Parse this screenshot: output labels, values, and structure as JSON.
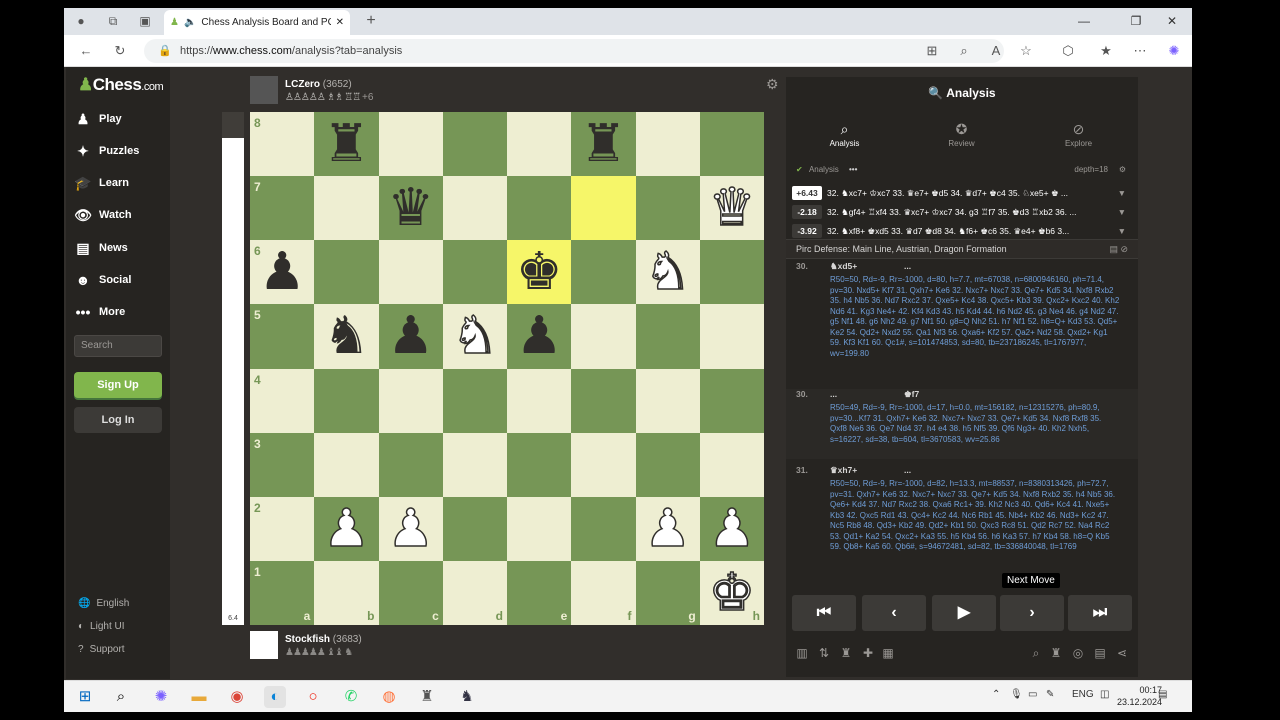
{
  "browser": {
    "tab_title": "Chess Analysis Board and PG",
    "url_prefix": "https://",
    "url_host": "www.chess.com",
    "url_path": "/analysis?tab=analysis"
  },
  "sidebar": {
    "logo_text": "Chess",
    "logo_domain": ".com",
    "items": [
      {
        "label": "Play",
        "icon": "♟"
      },
      {
        "label": "Puzzles",
        "icon": "✦"
      },
      {
        "label": "Learn",
        "icon": "🎓"
      },
      {
        "label": "Watch",
        "icon": "👁"
      },
      {
        "label": "News",
        "icon": "▤"
      },
      {
        "label": "Social",
        "icon": "☻"
      },
      {
        "label": "More",
        "icon": "•••"
      }
    ],
    "search_placeholder": "Search",
    "signup_label": "Sign Up",
    "login_label": "Log In",
    "settings": [
      {
        "label": "English",
        "icon": "🌐"
      },
      {
        "label": "Light UI",
        "icon": "◐"
      },
      {
        "label": "Support",
        "icon": "?"
      }
    ]
  },
  "board": {
    "top_player": {
      "name": "LCZero",
      "rating": "(3652)",
      "captured": "♙♙♙♙♙ ♗♗ ♖♖",
      "advantage": "+6"
    },
    "bottom_player": {
      "name": "Stockfish",
      "rating": "(3683)",
      "captured": "♟♟♟♟♟ ♝♝ ♞"
    },
    "eval_value": "6.4",
    "eval_white_fraction": 0.95,
    "ranks": [
      "8",
      "7",
      "6",
      "5",
      "4",
      "3",
      "2",
      "1"
    ],
    "files": [
      "a",
      "b",
      "c",
      "d",
      "e",
      "f",
      "g",
      "h"
    ],
    "highlight_squares": [
      "f7",
      "e6"
    ],
    "pieces": {
      "b8": "br",
      "f8": "br",
      "c7": "bq",
      "h7": "wq",
      "a6": "bp",
      "e6": "bk",
      "g6": "wn",
      "b5": "bn",
      "c5": "bp",
      "d5": "wn",
      "e5": "bp",
      "b2": "wp",
      "c2": "wp",
      "g2": "wp",
      "h2": "wp",
      "h1": "wk"
    }
  },
  "analysis": {
    "title": "Analysis",
    "tabs": [
      {
        "label": "Analysis",
        "icon": "search-icon"
      },
      {
        "label": "Review",
        "icon": "star-icon"
      },
      {
        "label": "Explore",
        "icon": "compass-icon"
      }
    ],
    "toggle_label": "Analysis",
    "depth": "depth=18",
    "lines": [
      {
        "eval": "+6.43",
        "moves": "32. ♞xc7+ ♔xc7 33. ♛e7+ ♚d5 34. ♛d7+ ♚c4 35. ♘xe5+ ♚ ..."
      },
      {
        "eval": "-2.18",
        "moves": "32. ♞gf4+ ♖xf4 33. ♛xc7+ ♔xc7 34. g3 ♖f7 35. ♚d3 ♖xb2 36. ..."
      },
      {
        "eval": "-3.92",
        "moves": "32. ♞xf8+ ♚xd5 33. ♛d7 ♚d8 34. ♞f6+ ♚c6 35. ♛e4+ ♚b6 3..."
      }
    ],
    "opening": "Pirc Defense: Main Line, Austrian, Dragon Formation",
    "move_blocks": [
      {
        "num": "30.",
        "white": "♞xd5+",
        "black": "...",
        "text": "R50=50, Rd=-9, Rr=-1000, d=80, h=7.7, mt=67038, n=6800946160, ph=71.4, pv=30. Nxd5+ Kf7 31. Qxh7+ Ke6 32. Nxc7+ Nxc7 33. Qe7+ Kd5 34. Nxf8 Rxb2 35. h4 Nb5 36. Nd7 Rxc2 37. Qxe5+ Kc4 38. Qxc5+ Kb3 39. Qxc2+ Kxc2 40. Kh2 Nd6 41. Kg3 Ne4+ 42. Kf4 Kd3 43. h5 Kd4 44. h6 Nd2 45. g3 Ne4 46. g4 Nd2 47. g5 Nf1 48. g6 Nh2 49. g7 Nf1 50. g8=Q Nh2 51. h7 Nf1 52. h8=Q+ Kd3 53. Qd5+ Ke2 54. Qd2+ Nxd2 55. Qa1 Nf3 56. Qxa6+ Kf2 57. Qa2+ Nd2 58. Qxd2+ Kg1 59. Kf3 Kf1 60. Qc1#, s=101474853, sd=80, tb=237186245, tl=1767977, wv=199.80"
      },
      {
        "num": "30.",
        "white": "...",
        "black": "♚f7",
        "text": "R50=49, Rd=-9, Rr=-1000, d=17, h=0.0, mt=156182, n=12315276, ph=80.9, pv=30...Kf7 31. Qxh7+ Ke6 32. Nxc7+ Nxc7 33. Qe7+ Kd5 34. Nxf8 Rxf8 35. Qxf8 Ne6 36. Qe7 Nd4 37. h4 e4 38. h5 Nf5 39. Qf6 Ng3+ 40. Kh2 Nxh5, s=16227, sd=38, tb=604, tl=3670583, wv=25.86"
      },
      {
        "num": "31.",
        "white": "♛xh7+",
        "black": "...",
        "text": "R50=50, Rd=-9, Rr=-1000, d=82, h=13.3, mt=88537, n=8380313426, ph=72.7, pv=31. Qxh7+ Ke6 32. Nxc7+ Nxc7 33. Qe7+ Kd5 34. Nxf8 Rxb2 35. h4 Nb5 36. Qe6+ Kd4 37. Nd7 Rxc2 38. Qxa6 Rc1+ 39. Kh2 Nc3 40. Qd6+ Kc4 41. Nxe5+ Kb3 42. Qxc5 Rd1 43. Qc4+ Kc2 44. Nc6 Rb1 45. Nb4+ Kb2 46. Nd3+ Kc2 47. Nc5 Rb8 48. Qd3+ Kb2 49. Qd2+ Kb1 50. Qxc3 Rc8 51. Qd2 Rc7 52. Na4 Rc2 53. Qd1+ Ka2 54. Qxc2+ Ka3 55. h5 Kb4 56. h6 Ka3 57. h7 Kb4 58. h8=Q Kb5 59. Qb8+ Ka5 60. Qb6#, s=94672481, sd=82, tb=336840048, tl=1769"
      }
    ],
    "tooltip": "Next Move"
  },
  "taskbar": {
    "lang": "ENG",
    "time": "00:17",
    "date": "23.12.2024"
  }
}
